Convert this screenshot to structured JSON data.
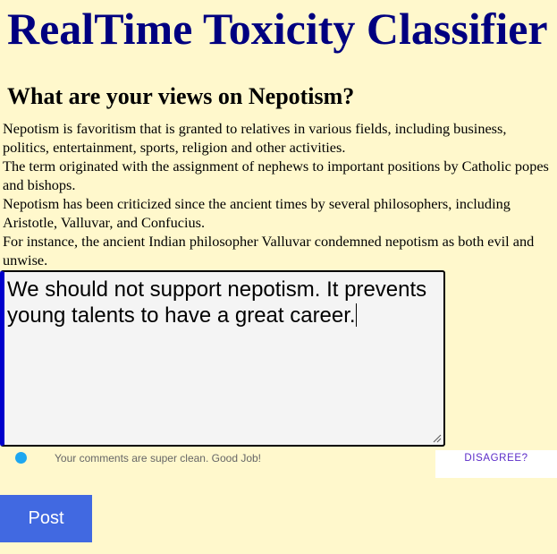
{
  "app": {
    "title": "RealTime Toxicity Classifier"
  },
  "topic": {
    "question": "What are your views on Nepotism?",
    "paragraphs": [
      "Nepotism is favoritism that is granted to relatives in various fields, including business, politics, entertainment, sports, religion and other activities.",
      "The term originated with the assignment of nephews to important positions by Catholic popes and bishops.",
      "Nepotism has been criticized since the ancient times by several philosophers, including Aristotle, Valluvar, and Confucius.",
      "For instance, the ancient Indian philosopher Valluvar condemned nepotism as both evil and unwise."
    ]
  },
  "comment": {
    "value": "We should not support nepotism. It prevents young talents to have a great career."
  },
  "feedback": {
    "status_text": "Your comments are super clean. Good Job!",
    "status_color": "#1ea7f0",
    "disagree_label": "DISAGREE?"
  },
  "actions": {
    "post_label": "Post",
    "post_color": "#4169e1"
  },
  "colors": {
    "background": "#fff8cc",
    "title": "#000080",
    "input_focus_border": "#0000cc"
  }
}
